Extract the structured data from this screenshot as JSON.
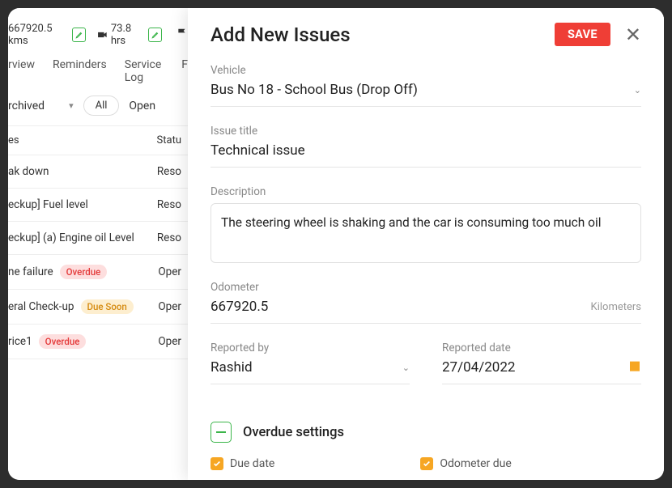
{
  "left": {
    "stats": {
      "kms": "667920.5 kms",
      "hrs": "73.8 hrs"
    },
    "tabs": {
      "overview": "rview",
      "reminders": "Reminders",
      "service": "Service Log",
      "more": "F"
    },
    "filters": {
      "archived": "rchived",
      "all": "All",
      "open": "Open"
    },
    "columns": {
      "title": "es",
      "status": "Statu"
    },
    "rows": [
      {
        "title": "ak down",
        "status": "Reso",
        "badge": null
      },
      {
        "title": "eckup] Fuel level",
        "status": "Reso",
        "badge": null
      },
      {
        "title": "eckup] (a) Engine oil Level",
        "status": "Reso",
        "badge": null
      },
      {
        "title": "ne failure",
        "status": "Oper",
        "badge": "Overdue",
        "badgeClass": "badge-overdue"
      },
      {
        "title": "eral Check-up",
        "status": "Oper",
        "badge": "Due Soon",
        "badgeClass": "badge-due"
      },
      {
        "title": "rice1",
        "status": "Oper",
        "badge": "Overdue",
        "badgeClass": "badge-overdue"
      }
    ]
  },
  "modal": {
    "title": "Add New Issues",
    "save": "SAVE",
    "vehicle": {
      "label": "Vehicle",
      "value": "Bus No 18 - School Bus (Drop Off)"
    },
    "issue": {
      "label": "Issue title",
      "value": "Technical issue"
    },
    "description": {
      "label": "Description",
      "value": "The steering wheel is shaking and the car is consuming too much oil"
    },
    "odometer": {
      "label": "Odometer",
      "value": "667920.5",
      "unit": "Kilometers"
    },
    "reportedBy": {
      "label": "Reported by",
      "value": "Rashid"
    },
    "reportedDate": {
      "label": "Reported date",
      "value": "27/04/2022"
    },
    "overdue": {
      "title": "Overdue settings",
      "dueDate": "Due date",
      "odoDue": "Odometer due"
    }
  }
}
